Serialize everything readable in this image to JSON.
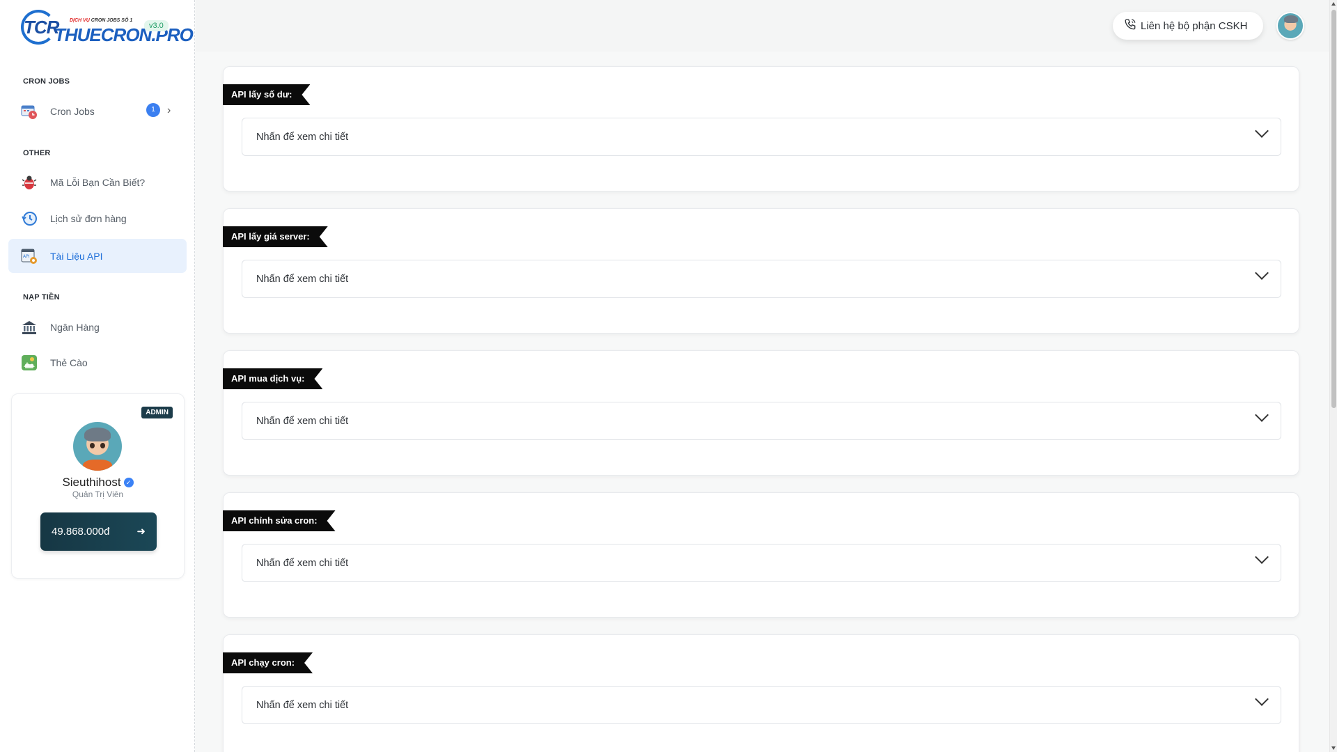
{
  "brand": {
    "logo_short": "TCR",
    "logo_tagline_red": "DỊCH VỤ",
    "logo_tagline": "CRON JOBS SỐ 1",
    "logo_name": "THUECRON.PRO",
    "version": "v3.0"
  },
  "sidebar": {
    "sections": {
      "cron_jobs": "CRON JOBS",
      "other": "OTHER",
      "nap_tien": "NẠP TIỀN"
    },
    "items": [
      {
        "label": "Cron Jobs",
        "badge": "1"
      },
      {
        "label": "Mã Lỗi Bạn Cần Biết?"
      },
      {
        "label": "Lịch sử đơn hàng"
      },
      {
        "label": "Tài Liệu API"
      },
      {
        "label": "Ngân Hàng"
      },
      {
        "label": "Thẻ Cào"
      }
    ]
  },
  "user": {
    "role_badge": "ADMIN",
    "name": "Sieuthihost",
    "role": "Quản Trị Viên",
    "balance": "49.868.000đ"
  },
  "header": {
    "contact_label": "Liên hệ bộ phận CSKH"
  },
  "api_sections": [
    {
      "title": "API lấy số dư:",
      "toggle": "Nhấn để xem chi tiết"
    },
    {
      "title": "API lấy giá server:",
      "toggle": "Nhấn để xem chi tiết"
    },
    {
      "title": "API mua dịch vụ:",
      "toggle": "Nhấn để xem chi tiết"
    },
    {
      "title": "API chỉnh sửa cron:",
      "toggle": "Nhấn để xem chi tiết"
    },
    {
      "title": "API chạy cron:",
      "toggle": "Nhấn để xem chi tiết"
    }
  ],
  "colors": {
    "accent": "#1e6fd9",
    "active_bg": "#e8f1fd",
    "ribbon": "#0b0b0b",
    "balance_btn": "#163744"
  }
}
